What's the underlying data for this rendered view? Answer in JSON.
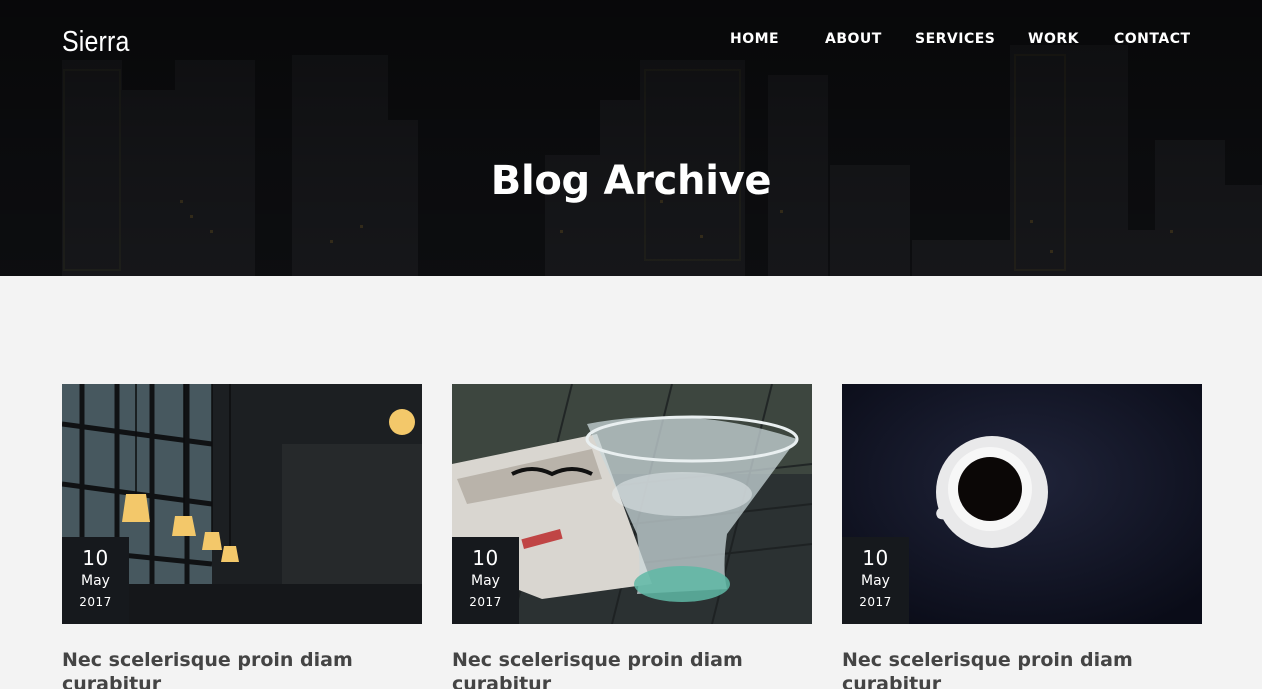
{
  "brand": {
    "name": "Sierra"
  },
  "nav": {
    "items": [
      {
        "label": "HOME"
      },
      {
        "label": "ABOUT"
      },
      {
        "label": "SERVICES"
      },
      {
        "label": "WORK"
      },
      {
        "label": "CONTACT"
      }
    ]
  },
  "hero": {
    "title": "Blog Archive"
  },
  "posts": [
    {
      "day": "10",
      "month": "May",
      "year": "2017",
      "title": "Nec scelerisque proin diam curabitur",
      "image": "cafe-pendant-lamps-photo"
    },
    {
      "day": "10",
      "month": "May",
      "year": "2017",
      "title": "Nec scelerisque proin diam curabitur",
      "image": "water-glass-magazine-photo"
    },
    {
      "day": "10",
      "month": "May",
      "year": "2017",
      "title": "Nec scelerisque proin diam curabitur",
      "image": "coffee-cup-top-view-photo"
    }
  ],
  "colors": {
    "page_bg": "#f3f3f3",
    "badge_bg": "#16191d",
    "title_text": "#444444"
  }
}
